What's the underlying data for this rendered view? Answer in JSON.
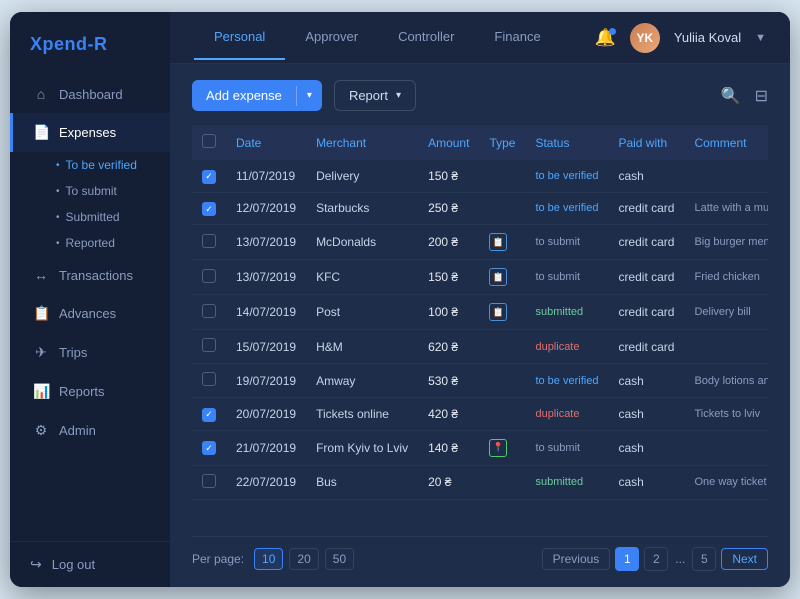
{
  "app": {
    "logo_text": "Xpend-",
    "logo_accent": "R"
  },
  "sidebar": {
    "items": [
      {
        "id": "dashboard",
        "label": "Dashboard",
        "icon": "⌂",
        "active": false
      },
      {
        "id": "expenses",
        "label": "Expenses",
        "icon": "📄",
        "active": true
      },
      {
        "id": "transactions",
        "label": "Transactions",
        "icon": "↔",
        "active": false
      },
      {
        "id": "advances",
        "label": "Advances",
        "icon": "📋",
        "active": false
      },
      {
        "id": "trips",
        "label": "Trips",
        "icon": "✈",
        "active": false
      },
      {
        "id": "reports",
        "label": "Reports",
        "icon": "📊",
        "active": false
      },
      {
        "id": "admin",
        "label": "Admin",
        "icon": "⚙",
        "active": false
      }
    ],
    "subitems": [
      {
        "id": "to-be-verified",
        "label": "To be verified",
        "active": true
      },
      {
        "id": "to-submit",
        "label": "To submit",
        "active": false
      },
      {
        "id": "submitted",
        "label": "Submitted",
        "active": false
      },
      {
        "id": "reported",
        "label": "Reported",
        "active": false
      }
    ],
    "logout_label": "Log out"
  },
  "topnav": {
    "tabs": [
      {
        "id": "personal",
        "label": "Personal",
        "active": true
      },
      {
        "id": "approver",
        "label": "Approver",
        "active": false
      },
      {
        "id": "controller",
        "label": "Controller",
        "active": false
      },
      {
        "id": "finance",
        "label": "Finance",
        "active": false
      }
    ],
    "user_name": "Yuliia Koval",
    "user_initials": "YK"
  },
  "toolbar": {
    "add_expense_label": "Add expense",
    "report_label": "Report"
  },
  "table": {
    "columns": [
      "",
      "Date",
      "Merchant",
      "Amount",
      "Type",
      "Status",
      "Paid with",
      "Comment"
    ],
    "rows": [
      {
        "checked": true,
        "date": "11/07/2019",
        "merchant": "Delivery",
        "amount": "150 ₴",
        "type": "",
        "status": "to be verified",
        "status_class": "verify",
        "paid_with": "cash",
        "comment": ""
      },
      {
        "checked": true,
        "date": "12/07/2019",
        "merchant": "Starbucks",
        "amount": "250 ₴",
        "type": "",
        "status": "to be verified",
        "status_class": "verify",
        "paid_with": "credit card",
        "comment": "Latte with a muffin"
      },
      {
        "checked": false,
        "date": "13/07/2019",
        "merchant": "McDonalds",
        "amount": "200 ₴",
        "type": "doc",
        "status": "to submit",
        "status_class": "submit",
        "paid_with": "credit card",
        "comment": "Big burger menu, cola light"
      },
      {
        "checked": false,
        "date": "13/07/2019",
        "merchant": "KFC",
        "amount": "150 ₴",
        "type": "doc",
        "status": "to submit",
        "status_class": "submit",
        "paid_with": "credit card",
        "comment": "Fried chicken"
      },
      {
        "checked": false,
        "date": "14/07/2019",
        "merchant": "Post",
        "amount": "100 ₴",
        "type": "doc",
        "status": "submitted",
        "status_class": "submitted",
        "paid_with": "credit card",
        "comment": "Delivery bill"
      },
      {
        "checked": false,
        "date": "15/07/2019",
        "merchant": "H&M",
        "amount": "620 ₴",
        "type": "",
        "status": "duplicate",
        "status_class": "duplicate",
        "paid_with": "credit card",
        "comment": ""
      },
      {
        "checked": false,
        "date": "19/07/2019",
        "merchant": "Amway",
        "amount": "530 ₴",
        "type": "",
        "status": "to be verified",
        "status_class": "verify",
        "paid_with": "cash",
        "comment": "Body lotions and scrub"
      },
      {
        "checked": true,
        "date": "20/07/2019",
        "merchant": "Tickets online",
        "amount": "420 ₴",
        "type": "",
        "status": "duplicate",
        "status_class": "duplicate",
        "paid_with": "cash",
        "comment": "Tickets to lviv"
      },
      {
        "checked": true,
        "date": "21/07/2019",
        "merchant": "From Kyiv to Lviv",
        "amount": "140 ₴",
        "type": "pin",
        "status": "to submit",
        "status_class": "submit",
        "paid_with": "cash",
        "comment": ""
      },
      {
        "checked": false,
        "date": "22/07/2019",
        "merchant": "Bus",
        "amount": "20 ₴",
        "type": "",
        "status": "submitted",
        "status_class": "submitted",
        "paid_with": "cash",
        "comment": "One way ticket"
      }
    ]
  },
  "pagination": {
    "per_page_label": "Per page:",
    "per_page_options": [
      "10",
      "20",
      "50"
    ],
    "per_page_active": "10",
    "pages": [
      "1",
      "2",
      "...",
      "5"
    ],
    "active_page": "1",
    "prev_label": "Previous",
    "next_label": "Next"
  }
}
